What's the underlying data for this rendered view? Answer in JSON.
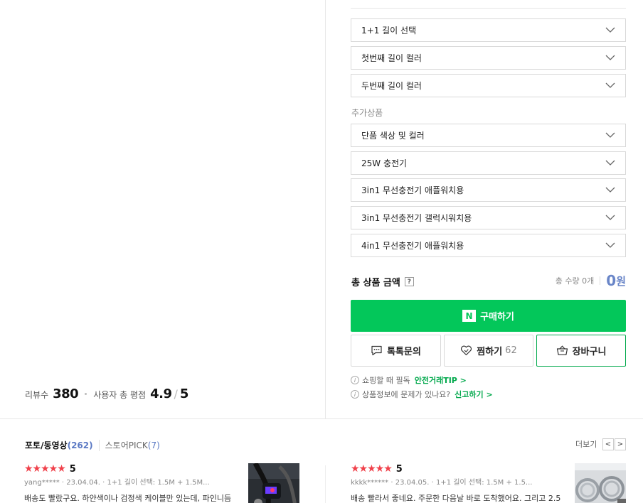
{
  "options": {
    "selects": [
      {
        "label": "1+1 길이 선택"
      },
      {
        "label": "첫번째 길이 컬러"
      },
      {
        "label": "두번째 길이 컬러"
      }
    ],
    "addon_label": "추가상품",
    "addons": [
      {
        "label": "단품 색상 및 컬러"
      },
      {
        "label": "25W 충전기"
      },
      {
        "label": "3in1 무선충전기 애플워치용"
      },
      {
        "label": "3in1 무선충전기 갤럭시워치용"
      },
      {
        "label": "4in1 무선충전기 애플워치용"
      }
    ]
  },
  "total": {
    "label": "총 상품 금액",
    "help": "?",
    "quantity_text": "총 수량 0개",
    "price": "0",
    "currency": "원"
  },
  "actions": {
    "buy_icon": "N",
    "buy_label": "구매하기",
    "talk_label": "톡톡문의",
    "wish_label": "찜하기",
    "wish_count": "62",
    "cart_label": "장바구니"
  },
  "notices": [
    {
      "text": "쇼핑할 때 필독",
      "link": "안전거래TIP >"
    },
    {
      "text": "상품정보에 문제가 있나요?",
      "link": "신고하기 >"
    }
  ],
  "summary": {
    "review_label": "리뷰수",
    "review_count": "380",
    "rating_label": "사용자 총 평점",
    "rating": "4.9",
    "slash": "/",
    "rating_max": "5"
  },
  "reviews_section": {
    "tab_photo": "포토/동영상",
    "tab_photo_count": "(262)",
    "tab_pick": "스토어PICK",
    "tab_pick_count": "(7)",
    "more": "더보기",
    "prev": "<",
    "next": ">",
    "star_glyphs": "★★★★★",
    "cards": [
      {
        "score": "5",
        "meta": "yang*****  · 23.04.04.  · 1+1 길이 선택: 1.5M + 1.5M...",
        "text": "배송도 빨랐구요. 하얀색이나 검정색 케이블만 있는데, 파인니듬"
      },
      {
        "score": "5",
        "meta": "kkkk******  · 23.04.05.  · 1+1 길이 선택: 1.5M + 1.5...",
        "text": "배송 빨라서 좋네요. 주문한 다음날 바로 도착했어요. 그리고 2.5"
      }
    ]
  },
  "colors": {
    "accent_green": "#03c75a",
    "price_blue": "#6a86c8",
    "star_red": "#f0414b"
  }
}
